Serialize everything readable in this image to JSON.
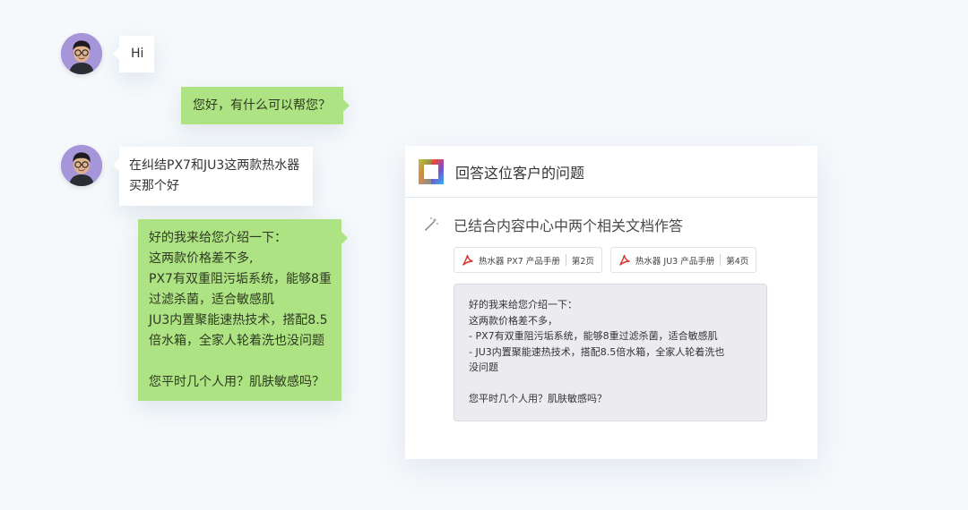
{
  "chat": {
    "messages": [
      {
        "from": "customer",
        "text": "Hi"
      },
      {
        "from": "agent",
        "text": "您好，有什么可以帮您？"
      },
      {
        "from": "customer",
        "lines": [
          "在纠结PX7和JU3这两款热水器",
          "买那个好"
        ]
      },
      {
        "from": "agent",
        "lines": [
          "好的我来给您介绍一下：",
          "这两款价格差不多,",
          "PX7有双重阻污垢系统，能够8重",
          "过滤杀菌，适合敏感肌",
          "JU3内置聚能速热技术，搭配8.5",
          "倍水箱，全家人轮着洗也没问题",
          "",
          "您平时几个人用？肌肤敏感吗？"
        ]
      }
    ]
  },
  "panel": {
    "title": "回答这位客户的问题",
    "summary": "已结合内容中心中两个相关文档作答",
    "documents": [
      {
        "name": "热水器 PX7 产品手册",
        "page": "第2页"
      },
      {
        "name": "热水器 JU3 产品手册",
        "page": "第4页"
      }
    ],
    "answer_lines": [
      "好的我来给您介绍一下：",
      "这两款价格差不多，",
      "-  PX7有双重阻污垢系统，能够8重过滤杀菌，适合敏感肌",
      "-  JU3内置聚能速热技术，搭配8.5倍水箱，全家人轮着洗也",
      "没问题",
      "",
      "您平时几个人用？肌肤敏感吗？"
    ]
  },
  "colors": {
    "agent_bubble": "#aee383",
    "customer_bubble": "#ffffff",
    "avatar_bg": "#a695d9",
    "pdf_red": "#d93025"
  },
  "icons": [
    "customer-avatar",
    "app-logo-icon",
    "magic-wand-icon",
    "pdf-icon"
  ]
}
